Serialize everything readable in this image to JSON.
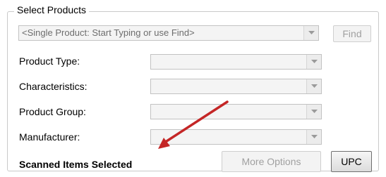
{
  "group": {
    "title": "Select Products"
  },
  "single_product": {
    "text": "<Single Product: Start Typing or use Find>",
    "find_label": "Find"
  },
  "fields": {
    "product_type": "Product Type:",
    "characteristics": "Characteristics:",
    "product_group": "Product Group:",
    "manufacturer": "Manufacturer:"
  },
  "bottom": {
    "scanned_label": "Scanned Items Selected",
    "more_options_label": "More Options",
    "upc_label": "UPC"
  },
  "colors": {
    "arrow": "#c42626"
  },
  "icons": {
    "dropdown": "chevron-down-icon",
    "annotation": "arrow-icon"
  }
}
